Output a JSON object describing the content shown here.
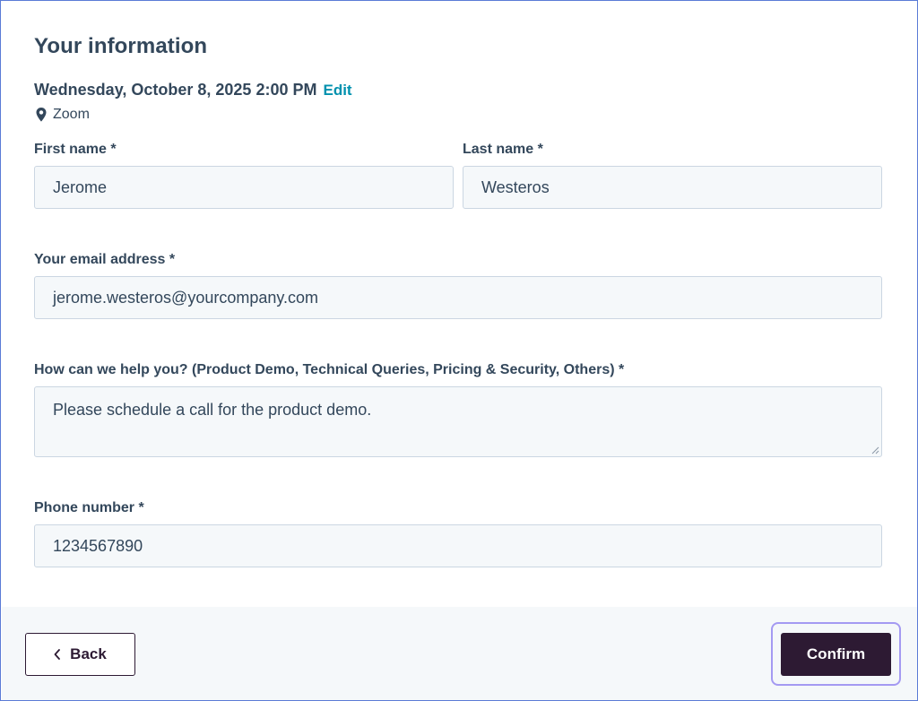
{
  "header": {
    "title": "Your information",
    "datetime": "Wednesday, October 8, 2025 2:00 PM",
    "edit_label": "Edit",
    "location": "Zoom"
  },
  "form": {
    "first_name": {
      "label": "First name *",
      "value": "Jerome"
    },
    "last_name": {
      "label": "Last name *",
      "value": "Westeros"
    },
    "email": {
      "label": "Your email address *",
      "value": "jerome.westeros@yourcompany.com"
    },
    "help": {
      "label": "How can we help you? (Product Demo, Technical Queries, Pricing & Security, Others) *",
      "value": "Please schedule a call for the product demo."
    },
    "phone": {
      "label": "Phone number *",
      "value": "1234567890"
    }
  },
  "footer": {
    "back_label": "Back",
    "confirm_label": "Confirm"
  },
  "colors": {
    "brand_dark": "#2d1a33",
    "link": "#0091ae",
    "text": "#33475b",
    "input_bg": "#f5f8fa",
    "focus_ring": "#a49af2"
  },
  "icons": {
    "location": "map-pin-icon",
    "back": "chevron-left-icon"
  }
}
